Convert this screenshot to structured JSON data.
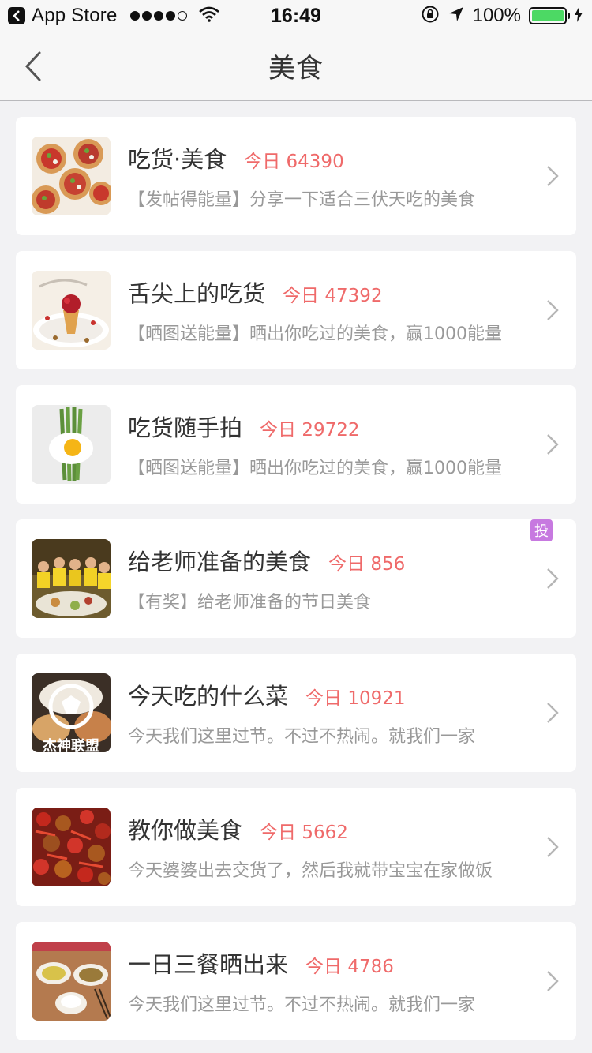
{
  "status_bar": {
    "back_app_label": "App Store",
    "time": "16:49",
    "battery": "100%",
    "battery_level": 1.0
  },
  "nav": {
    "title": "美食"
  },
  "items": [
    {
      "title": "吃货·美食",
      "today_label": "今日 64390",
      "desc": "【发帖得能量】分享一下适合三伏天吃的美食",
      "thumb_icon": "tart-dish-photo"
    },
    {
      "title": "舌尖上的吃货",
      "today_label": "今日 47392",
      "desc": "【晒图送能量】晒出你吃过的美食，赢1000能量",
      "thumb_icon": "dessert-plate-photo"
    },
    {
      "title": "吃货随手拍",
      "today_label": "今日 29722",
      "desc": "【晒图送能量】晒出你吃过的美食，赢1000能量",
      "thumb_icon": "egg-asparagus-photo"
    },
    {
      "title": "给老师准备的美食",
      "today_label": "今日 856",
      "desc": "【有奖】给老师准备的节日美食",
      "thumb_icon": "group-dinner-photo",
      "badge": "投"
    },
    {
      "title": "今天吃的什么菜",
      "today_label": "今日 10921",
      "desc": "今天我们这里过节。不过不热闹。就我们一家",
      "thumb_icon": "logo-dish-photo",
      "thumb_text": "杰神联盟"
    },
    {
      "title": "教你做美食",
      "today_label": "今日 5662",
      "desc": "今天婆婆出去交货了，然后我就带宝宝在家做饭",
      "thumb_icon": "spicy-chicken-photo"
    },
    {
      "title": "一日三餐晒出来",
      "today_label": "今日 4786",
      "desc": "今天我们这里过节。不过不热闹。就我们一家",
      "thumb_icon": "table-meal-photo"
    }
  ]
}
